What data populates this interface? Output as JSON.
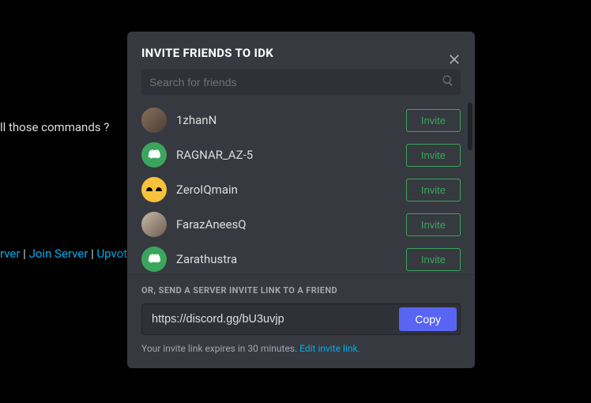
{
  "background": {
    "line1": "ll those commands ?",
    "server_suffix": "rver",
    "join": "Join Server",
    "upvote": "Upvote"
  },
  "modal": {
    "title": "INVITE FRIENDS TO IDK",
    "search_placeholder": "Search for friends"
  },
  "friends": [
    {
      "name": "1zhanN",
      "avatar_type": "photo1",
      "invite_label": "Invite"
    },
    {
      "name": "RAGNAR_AZ-5",
      "avatar_type": "discord",
      "invite_label": "Invite"
    },
    {
      "name": "ZeroIQmain",
      "avatar_type": "yellow_eyes",
      "invite_label": "Invite"
    },
    {
      "name": "FarazAneesQ",
      "avatar_type": "photo2",
      "invite_label": "Invite"
    },
    {
      "name": "Zarathustra",
      "avatar_type": "discord",
      "invite_label": "Invite"
    }
  ],
  "divider_label": "OR, SEND A SERVER INVITE LINK TO A FRIEND",
  "invite_link": "https://discord.gg/bU3uvjp",
  "copy_label": "Copy",
  "footer": {
    "expire_text": "Your invite link expires in 30 minutes. ",
    "edit_link": "Edit invite link."
  },
  "colors": {
    "accent_green": "#3ba55d",
    "accent_blue": "#5865f2",
    "link_blue": "#00afef"
  }
}
